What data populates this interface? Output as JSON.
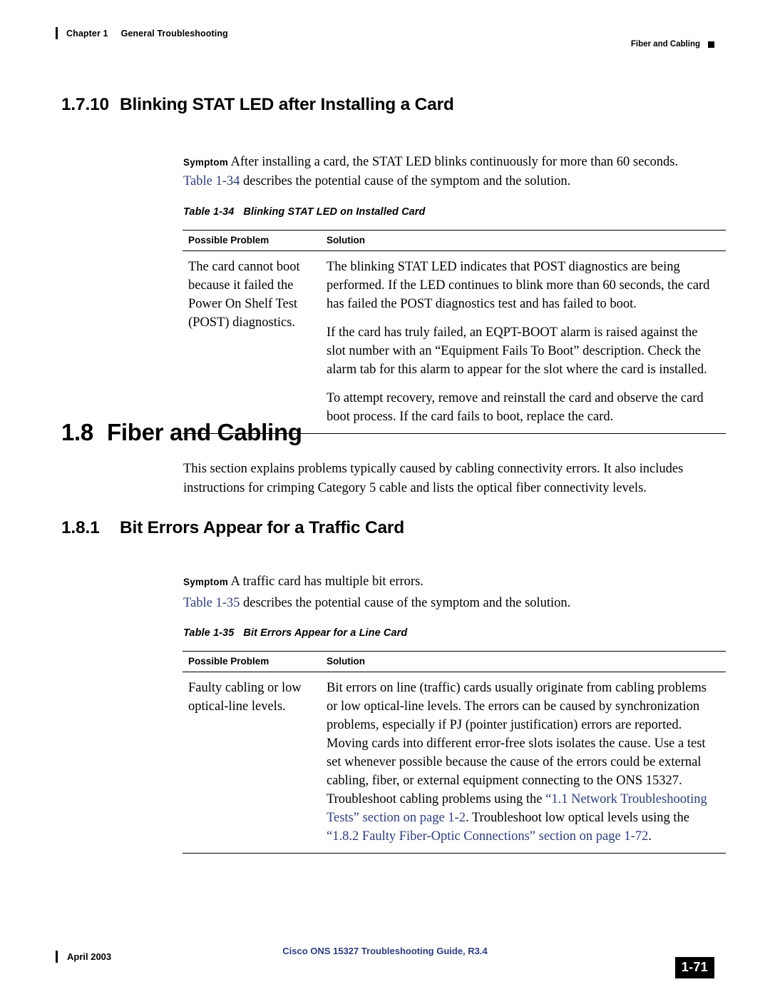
{
  "header": {
    "chapter_num": "Chapter 1",
    "chapter_title": "General Troubleshooting",
    "running_head": "Fiber and Cabling"
  },
  "sections": {
    "s1710": {
      "number": "1.7.10",
      "title": "Blinking STAT LED after Installing a Card",
      "symptom_label": "Symptom",
      "symptom_text": "After installing a card, the STAT LED blinks continuously for more than 60 seconds.",
      "intro_xref": "Table 1-34",
      "intro_rest": " describes the potential cause of the symptom and the solution."
    },
    "s18": {
      "number": "1.8",
      "title": "Fiber and Cabling",
      "body": "This section explains problems typically caused by cabling connectivity errors. It also includes instructions for crimping Category 5 cable and lists the optical fiber connectivity levels."
    },
    "s181": {
      "number": "1.8.1",
      "title": "Bit Errors Appear for a Traffic Card",
      "symptom_label": "Symptom",
      "symptom_text": "A traffic card has multiple bit errors.",
      "intro_xref": "Table 1-35",
      "intro_rest": " describes the potential cause of the symptom and the solution."
    }
  },
  "table_134": {
    "caption_num": "Table 1-34",
    "caption_title": "Blinking STAT LED on Installed Card",
    "headers": [
      "Possible Problem",
      "Solution"
    ],
    "rows": [
      {
        "problem": "The card cannot boot because it failed the Power On Shelf Test (POST) diagnostics.",
        "solution": [
          "The blinking STAT LED indicates that POST diagnostics are being performed. If the LED continues to blink more than 60 seconds, the card has failed the POST diagnostics test and has failed to boot.",
          "If the card has truly failed, an EQPT-BOOT alarm is raised against the slot number with an “Equipment Fails To Boot” description. Check the alarm tab for this alarm to appear for the slot where the card is installed.",
          "To attempt recovery, remove and reinstall the card and observe the card boot process. If the card fails to boot, replace the card."
        ]
      }
    ]
  },
  "table_135": {
    "caption_num": "Table 1-35",
    "caption_title": "Bit Errors Appear for a Line Card",
    "headers": [
      "Possible Problem",
      "Solution"
    ],
    "rows": [
      {
        "problem": "Faulty cabling or low optical-line levels.",
        "solution_part1": "Bit errors on line (traffic) cards usually originate from cabling problems or low optical-line levels. The errors can be caused by synchronization problems, especially if PJ (pointer justification) errors are reported. Moving cards into different error-free slots isolates the cause. Use a test set whenever possible because the cause of the errors could be external cabling, fiber, or external equipment connecting to the ONS 15327. Troubleshoot cabling problems using the ",
        "solution_link1": "“1.1 Network Troubleshooting Tests” section on page 1-2",
        "solution_part2": ". Troubleshoot low optical levels using the ",
        "solution_link2": "“1.8.2 Faulty Fiber-Optic Connections” section on page 1-72",
        "solution_part3": "."
      }
    ]
  },
  "footer": {
    "date": "April 2003",
    "doc_title": "Cisco ONS 15327 Troubleshooting Guide, R3.4",
    "page_number": "1-71"
  },
  "colors": {
    "link": "#2b3c8e",
    "rule": "#000000"
  }
}
